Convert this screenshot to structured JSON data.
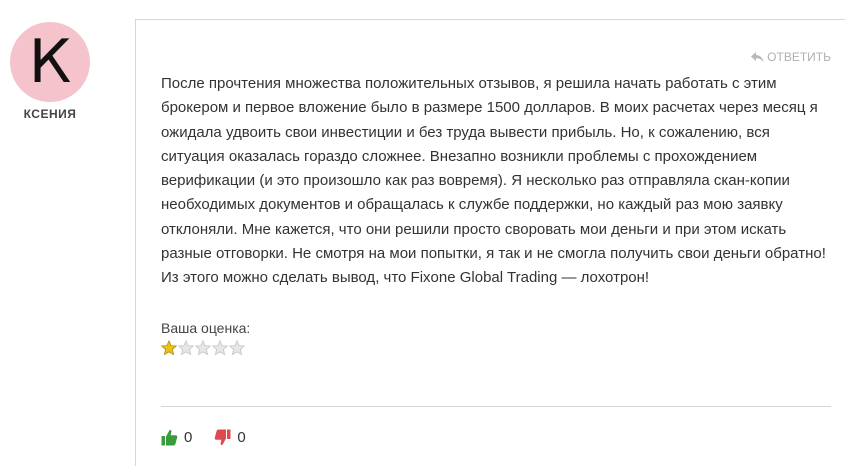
{
  "author": {
    "initial": "К",
    "name": "КСЕНИЯ",
    "avatar_color": "#f4c3cc"
  },
  "comment": {
    "reply_label": "ОТВЕТИТЬ",
    "reply_icon": "reply-arrow-icon",
    "text": "После прочтения множества положительных отзывов, я решила начать работать с этим брокером и первое вложение было в размере 1500 долларов. В моих расчетах через месяц я ожидала удвоить свои инвестиции и без труда вывести прибыль. Но, к сожалению, вся ситуация оказалась гораздо сложнее. Внезапно возникли проблемы с прохождением верификации (и это произошло как раз вовремя). Я несколько раз отправляла скан-копии необходимых документов и обращалась к службе поддержки, но каждый раз мою заявку отклоняли. Мне кажется, что они решили просто своровать мои деньги и при этом искать разные отговорки. Не смотря на мои попытки, я так и не смогла получить свои деньги обратно! Из этого можно сделать вывод, что Fixone Global Trading — лохотрон!"
  },
  "rating": {
    "label": "Ваша оценка:",
    "value": 1,
    "max": 5,
    "filled_color": "#e8c21a",
    "empty_color": "#e6e6e6"
  },
  "votes": {
    "up_count": "0",
    "down_count": "0",
    "up_icon": "thumbs-up-icon",
    "down_icon": "thumbs-down-icon",
    "up_color": "#3a9b3a",
    "down_color": "#e0484f"
  }
}
